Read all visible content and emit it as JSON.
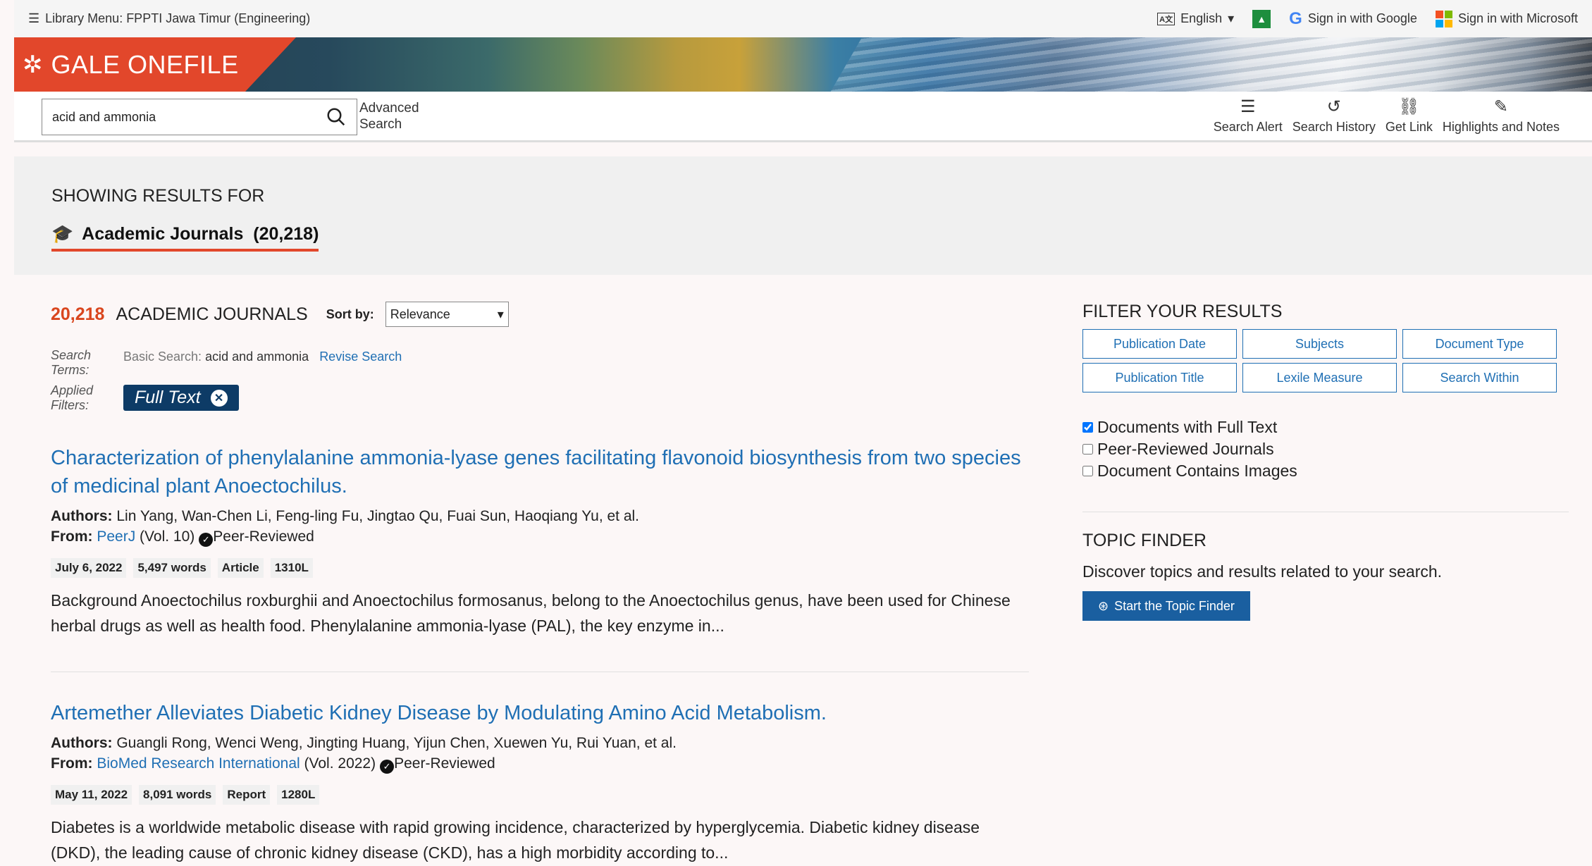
{
  "topbar": {
    "library_menu": "Library Menu: FPPTI Jawa Timur (Engineering)",
    "language": "English",
    "google_signin": "Sign in with Google",
    "microsoft_signin": "Sign in with Microsoft"
  },
  "brand": {
    "name": "GALE ONEFILE"
  },
  "search": {
    "value": "acid and ammonia",
    "advanced_line1": "Advanced",
    "advanced_line2": "Search"
  },
  "tools": [
    {
      "label": "Search Alert",
      "icon": "rss-icon"
    },
    {
      "label": "Search History",
      "icon": "history-icon"
    },
    {
      "label": "Get Link",
      "icon": "link-icon"
    },
    {
      "label": "Highlights and Notes",
      "icon": "pen-icon"
    }
  ],
  "showing": {
    "label": "SHOWING RESULTS FOR",
    "tab": "Academic Journals  (20,218)"
  },
  "results": {
    "count": "20,218",
    "count_label": "ACADEMIC JOURNALS",
    "sort_label": "Sort by:",
    "sort_value": "Relevance",
    "search_terms_label1": "Search",
    "search_terms_label2": "Terms:",
    "basic_search_label": "Basic Search:",
    "basic_search_value": "acid and ammonia",
    "revise": "Revise Search",
    "filters_label1": "Applied",
    "filters_label2": "Filters:",
    "filter_pill": "Full Text",
    "items": [
      {
        "title": "Characterization of phenylalanine ammonia-lyase genes facilitating flavonoid biosynthesis from two species of medicinal plant Anoectochilus.",
        "authors_label": "Authors:",
        "authors": "Lin Yang, Wan-Chen Li, Feng-ling Fu, Jingtao Qu, Fuai Sun, Haoqiang Yu, et al.",
        "from_label": "From:",
        "source": "PeerJ",
        "vol": "(Vol. 10)",
        "peer": "Peer-Reviewed",
        "tags": [
          "July 6, 2022",
          "5,497 words",
          "Article",
          "1310L"
        ],
        "abstract": "Background Anoectochilus roxburghii and Anoectochilus formosanus, belong to the Anoectochilus genus, have been used for Chinese herbal drugs as well as health food. Phenylalanine ammonia-lyase (PAL), the key enzyme in..."
      },
      {
        "title": "Artemether Alleviates Diabetic Kidney Disease by Modulating Amino Acid Metabolism.",
        "authors_label": "Authors:",
        "authors": "Guangli Rong, Wenci Weng, Jingting Huang, Yijun Chen, Xuewen Yu, Rui Yuan, et al.",
        "from_label": "From:",
        "source": "BioMed Research International",
        "vol": "(Vol. 2022)",
        "peer": "Peer-Reviewed",
        "tags": [
          "May 11, 2022",
          "8,091 words",
          "Report",
          "1280L"
        ],
        "abstract": "Diabetes is a worldwide metabolic disease with rapid growing incidence, characterized by hyperglycemia. Diabetic kidney disease (DKD), the leading cause of chronic kidney disease (CKD), has a high morbidity according to..."
      }
    ]
  },
  "filter": {
    "heading": "FILTER YOUR RESULTS",
    "buttons": [
      "Publication Date",
      "Subjects",
      "Document Type",
      "Publication Title",
      "Lexile Measure",
      "Search Within"
    ],
    "checks": [
      {
        "label": "Documents with Full Text",
        "checked": true
      },
      {
        "label": "Peer-Reviewed Journals",
        "checked": false
      },
      {
        "label": "Document Contains Images",
        "checked": false
      }
    ]
  },
  "topic": {
    "heading": "TOPIC FINDER",
    "desc": "Discover topics and results related to your search.",
    "button": "Start the Topic Finder"
  },
  "colors": {
    "brand": "#e2472b",
    "link": "#1f6fb4",
    "pill": "#0d3b66",
    "count": "#d9461e"
  }
}
